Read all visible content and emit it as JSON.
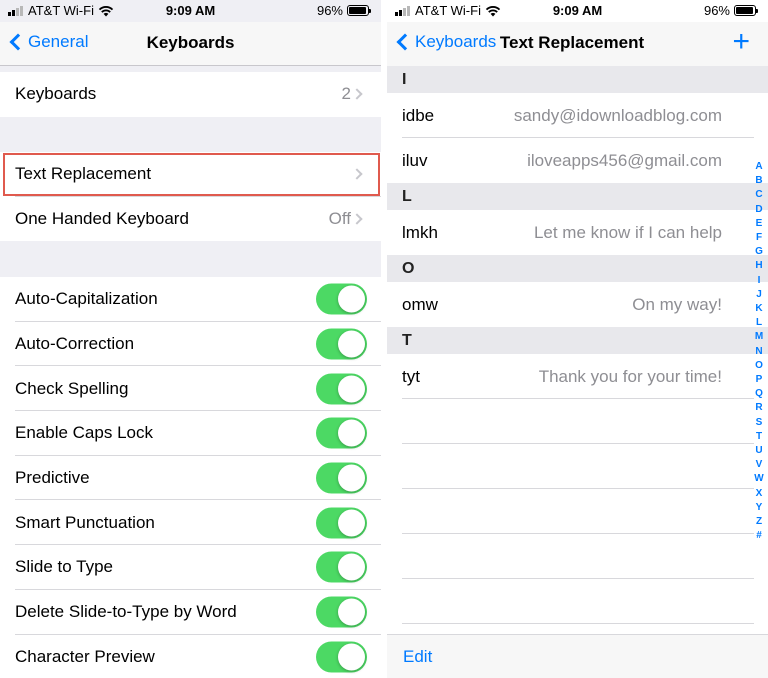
{
  "status": {
    "carrier": "AT&T Wi-Fi",
    "time": "9:09 AM",
    "battery": "96%",
    "battery_level": 0.96
  },
  "left": {
    "nav": {
      "back_label": "General",
      "title": "Keyboards"
    },
    "keyboards_row": {
      "label": "Keyboards",
      "value": "2"
    },
    "text_replacement_row": {
      "label": "Text Replacement"
    },
    "one_handed_row": {
      "label": "One Handed Keyboard",
      "value": "Off"
    },
    "toggles": [
      {
        "label": "Auto-Capitalization",
        "on": true
      },
      {
        "label": "Auto-Correction",
        "on": true
      },
      {
        "label": "Check Spelling",
        "on": true
      },
      {
        "label": "Enable Caps Lock",
        "on": true
      },
      {
        "label": "Predictive",
        "on": true
      },
      {
        "label": "Smart Punctuation",
        "on": true
      },
      {
        "label": "Slide to Type",
        "on": true
      },
      {
        "label": "Delete Slide-to-Type by Word",
        "on": true
      },
      {
        "label": "Character Preview",
        "on": true
      }
    ],
    "highlight_color": "#e05a4e",
    "toggle_color": "#4cd964"
  },
  "right": {
    "nav": {
      "back_label": "Keyboards",
      "title": "Text Replacement",
      "add_label": "+"
    },
    "sections": [
      {
        "header": "I",
        "items": [
          {
            "shortcut": "idbe",
            "phrase": "sandy@idownloadblog.com"
          },
          {
            "shortcut": "iluv",
            "phrase": "iloveapps456@gmail.com"
          }
        ]
      },
      {
        "header": "L",
        "items": [
          {
            "shortcut": "lmkh",
            "phrase": "Let me know if I can help"
          }
        ]
      },
      {
        "header": "O",
        "items": [
          {
            "shortcut": "omw",
            "phrase": "On my way!"
          }
        ]
      },
      {
        "header": "T",
        "items": [
          {
            "shortcut": "tyt",
            "phrase": "Thank you for your time!"
          }
        ]
      }
    ],
    "index_letters": [
      "A",
      "B",
      "C",
      "D",
      "E",
      "F",
      "G",
      "H",
      "I",
      "J",
      "K",
      "L",
      "M",
      "N",
      "O",
      "P",
      "Q",
      "R",
      "S",
      "T",
      "U",
      "V",
      "W",
      "X",
      "Y",
      "Z",
      "#"
    ],
    "toolbar": {
      "edit_label": "Edit"
    },
    "accent_color": "#007aff"
  }
}
